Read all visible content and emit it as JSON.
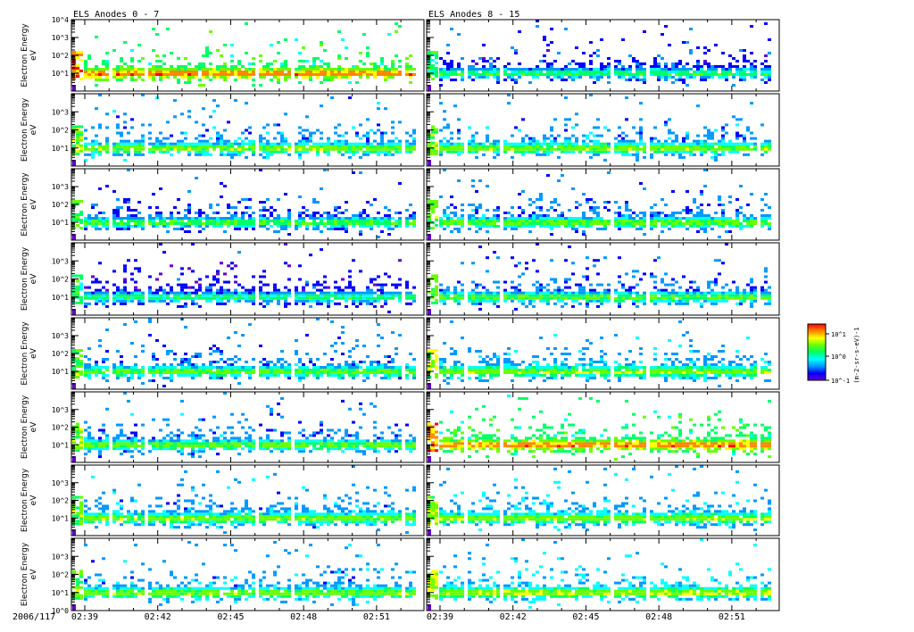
{
  "chart_data": {
    "type": "heatmap",
    "titles": [
      "ELS Anodes 0 - 7",
      "ELS Anodes 8 - 15"
    ],
    "ylabel": "Electron Energy",
    "yunits": "eV",
    "yscale": "log",
    "ylim": [
      1,
      10000
    ],
    "ytick_labels_top": [
      "10^4",
      "10^3",
      "10^2",
      "10^1"
    ],
    "ytick_labels": [
      "10^3",
      "10^2",
      "10^1"
    ],
    "ytick_label_bottom": "10^0",
    "date_label": "2006/117",
    "xtick_labels": [
      "02:39",
      "02:42",
      "02:45",
      "02:48",
      "02:51"
    ],
    "xtick_minutes": [
      159,
      162,
      165,
      168,
      171
    ],
    "xlim_minutes": [
      158.45,
      172.95
    ],
    "rows": 8,
    "columns": 2,
    "peak_energy_eV": 8,
    "panel_intensity": [
      [
        0.62,
        0.3
      ],
      [
        0.4,
        0.4
      ],
      [
        0.33,
        0.38
      ],
      [
        0.28,
        0.36
      ],
      [
        0.38,
        0.42
      ],
      [
        0.38,
        0.62
      ],
      [
        0.4,
        0.42
      ],
      [
        0.4,
        0.45
      ]
    ],
    "colorbar": {
      "label": "(m-2-sr-s-eV)-1",
      "tick_labels": [
        "10^1",
        "10^0",
        "10^-1"
      ],
      "colors": [
        "#6600cc",
        "#0000ff",
        "#0099ff",
        "#00ffff",
        "#00ff66",
        "#66ff00",
        "#ffff00",
        "#ff8800",
        "#ff0000"
      ]
    }
  }
}
